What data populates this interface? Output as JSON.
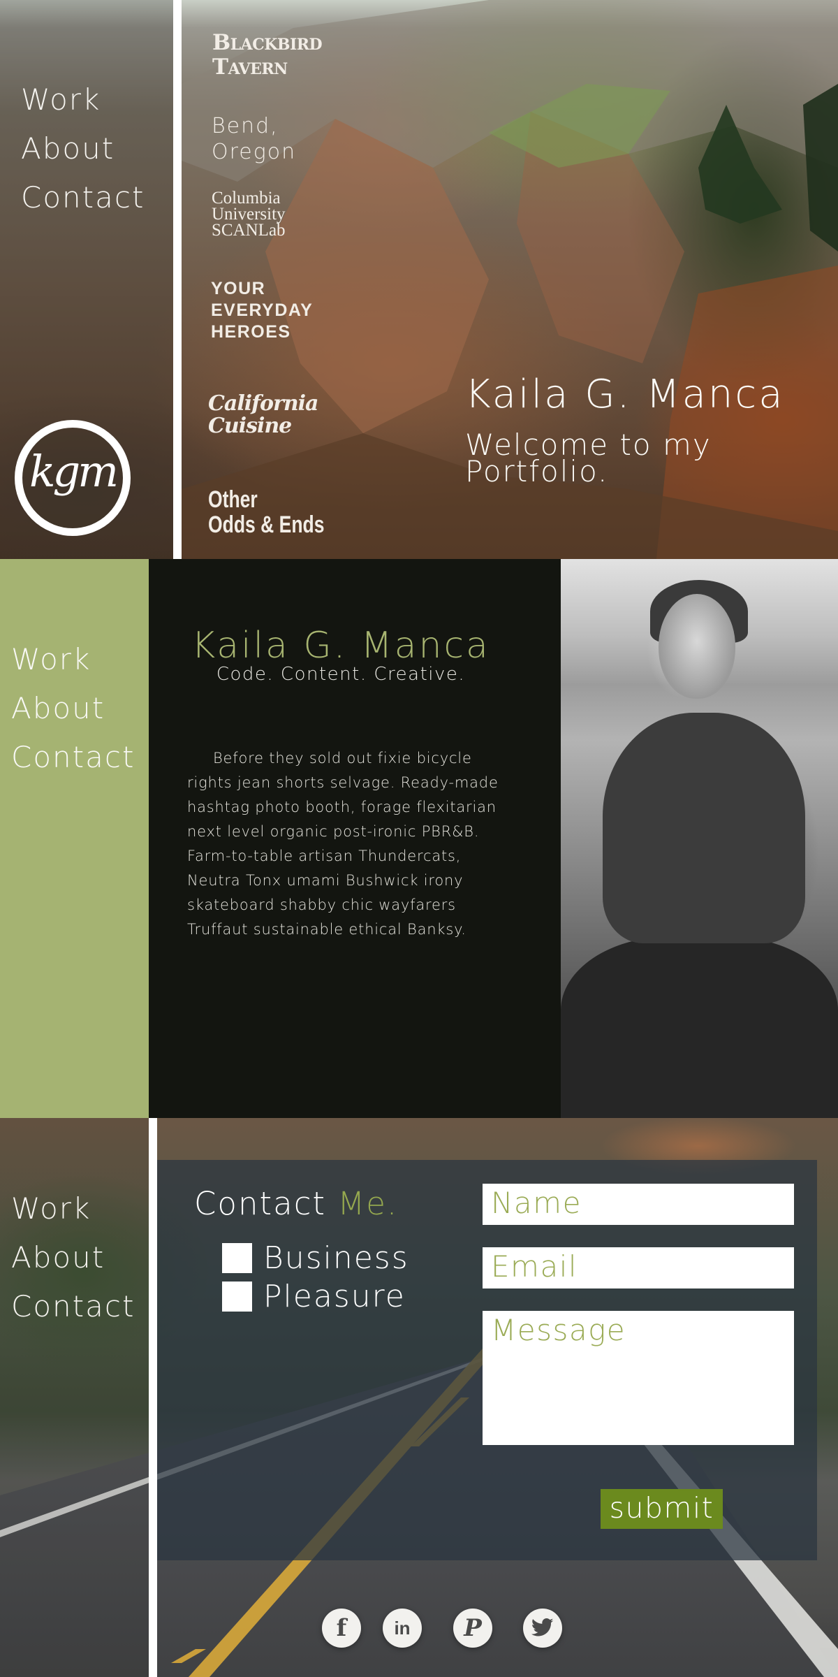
{
  "nav": {
    "items": [
      {
        "label": "Work"
      },
      {
        "label": "About"
      },
      {
        "label": "Contact"
      }
    ]
  },
  "hero": {
    "logo_text": "kgm",
    "projects": {
      "blackbird_line1": "Blackbird",
      "blackbird_line2": "Tavern",
      "bend_line1": "Bend,",
      "bend_line2": "Oregon",
      "columbia_line1": "Columbia",
      "columbia_line2": "University",
      "columbia_line3": "SCANLab",
      "heroes_line1": "YOUR",
      "heroes_line2": "EVERYDAY",
      "heroes_line3": "HEROES",
      "california_line1": "California",
      "california_line2": "Cuisine",
      "other_line1": "Other",
      "other_line2": "Odds & Ends"
    },
    "name": "Kaila G. Manca",
    "welcome": "Welcome to my Portfolio."
  },
  "about": {
    "name": "Kaila G. Manca",
    "tagline": "Code. Content. Creative.",
    "bio": "Before they sold out fixie bicycle rights jean shorts selvage. Ready-made hashtag photo booth, forage flexitarian next level organic post-ironic PBR&B. Farm-to-table artisan Thundercats, Neutra Tonx umami Bushwick irony skateboard shabby chic wayfarers Truffaut sustainable ethical Banksy."
  },
  "contact": {
    "title": "Contact",
    "title_accent": "Me.",
    "options": [
      {
        "label": "Business"
      },
      {
        "label": "Pleasure"
      }
    ],
    "name_placeholder": "Name",
    "email_placeholder": "Email",
    "message_placeholder": "Message",
    "submit_label": "submit"
  },
  "social": {
    "facebook": "f",
    "linkedin": "in",
    "pinterest": "P"
  },
  "colors": {
    "accent_green": "#a5b372",
    "button_green": "#6b8a1e",
    "dark_bg": "#131510"
  }
}
